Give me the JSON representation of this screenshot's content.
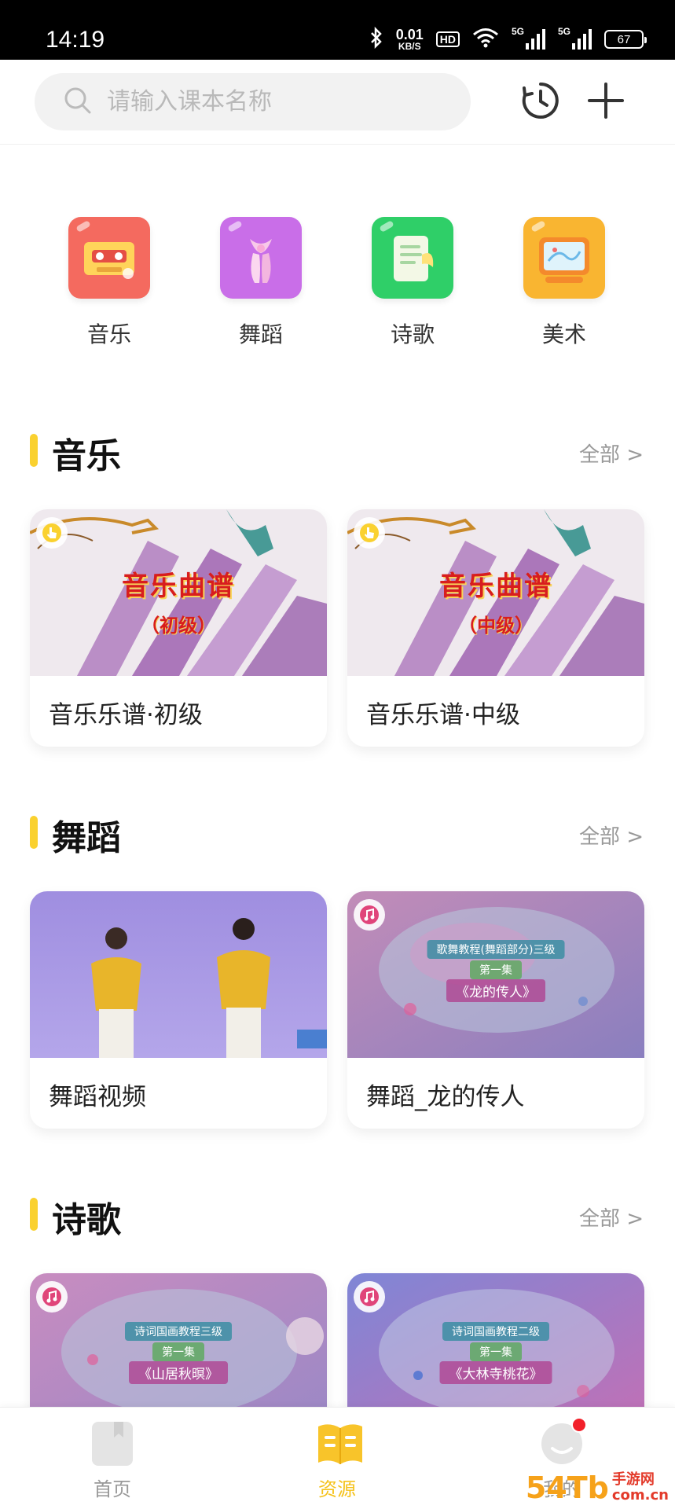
{
  "status_bar": {
    "time": "14:19",
    "net_speed_value": "0.01",
    "net_speed_unit": "KB/S",
    "hd_label": "HD",
    "signal1_label": "5G",
    "signal2_label": "5G",
    "battery": "67"
  },
  "header": {
    "search_placeholder": "请输入课本名称"
  },
  "categories": [
    {
      "label": "音乐",
      "color": "#f46a5f"
    },
    {
      "label": "舞蹈",
      "color": "#c96ee8"
    },
    {
      "label": "诗歌",
      "color": "#2fcf68"
    },
    {
      "label": "美术",
      "color": "#f9b531"
    }
  ],
  "sections": [
    {
      "title": "音乐",
      "more": "全部 >",
      "cards": [
        {
          "title": "音乐乐谱·初级",
          "thumb_main": "音乐曲谱",
          "thumb_sub": "（初级）"
        },
        {
          "title": "音乐乐谱·中级",
          "thumb_main": "音乐曲谱",
          "thumb_sub": "（中级）"
        }
      ]
    },
    {
      "title": "舞蹈",
      "more": "全部 >",
      "cards": [
        {
          "title": "舞蹈视频"
        },
        {
          "title": "舞蹈_龙的传人",
          "thumb_level": "歌舞教程(舞蹈部分)三级",
          "thumb_episode": "第一集",
          "thumb_name": "《龙的传人》"
        }
      ]
    },
    {
      "title": "诗歌",
      "more": "全部 >",
      "cards": [
        {
          "title": "",
          "thumb_level": "诗词国画教程三级",
          "thumb_episode": "第一集",
          "thumb_name": "《山居秋暝》"
        },
        {
          "title": "",
          "thumb_level": "诗词国画教程二级",
          "thumb_episode": "第一集",
          "thumb_name": "《大林寺桃花》"
        }
      ]
    }
  ],
  "bottom_nav": [
    {
      "label": "首页"
    },
    {
      "label": "资源"
    },
    {
      "label": "我的"
    }
  ],
  "watermark": {
    "text": "54Tb",
    "sub1": "手游网",
    "sub2": "com.cn"
  },
  "colors": {
    "accent": "#fad12f",
    "active_tab": "#f5c21a",
    "notification_dot": "#f2202a"
  }
}
